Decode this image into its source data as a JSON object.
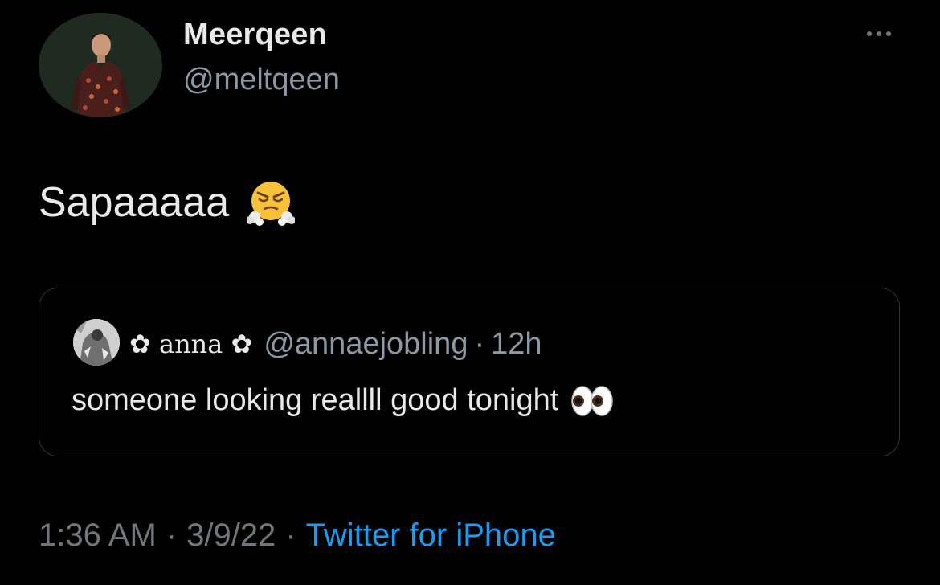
{
  "author": {
    "display_name": "Meerqeen",
    "handle": "@meltqeen",
    "avatar_icon": "profile-photo-man-patterned-shirt"
  },
  "tweet": {
    "text": "Sapaaaaa",
    "emoji": "face-with-steam-from-nose"
  },
  "quote": {
    "name": "✿ anna ✿",
    "handle": "@annaejobling",
    "separator": "·",
    "time": "12h",
    "text": "someone looking reallll good tonight",
    "emoji": "eyes"
  },
  "meta": {
    "time": "1:36 AM",
    "date": "3/9/22",
    "separator": "·",
    "source": "Twitter for iPhone"
  },
  "colors": {
    "background": "#000000",
    "primary_text": "#e7e9ea",
    "secondary_text": "#8b98a5",
    "link": "#1d9bf0",
    "border": "#2f3336"
  }
}
